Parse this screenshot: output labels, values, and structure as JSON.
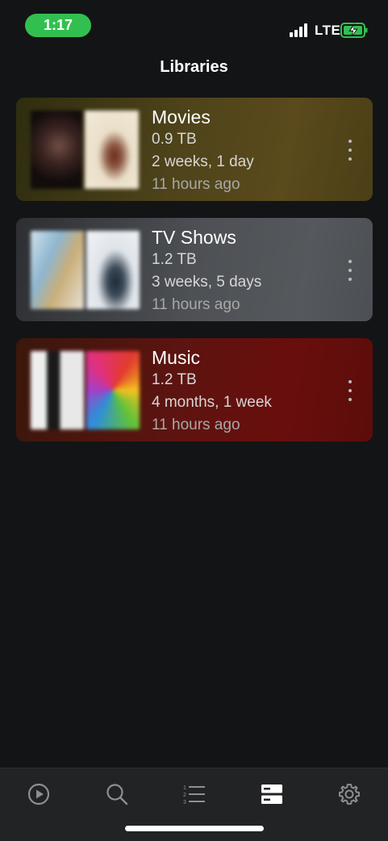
{
  "status_bar": {
    "time": "1:17",
    "network": "LTE",
    "time_pill_color": "#31c04f",
    "battery_color": "#31c04f"
  },
  "header": {
    "title": "Libraries"
  },
  "libraries": [
    {
      "title": "Movies",
      "size": "0.9 TB",
      "duration": "2 weeks, 1 day",
      "updated": "11 hours ago",
      "tint": "#4e431a",
      "menu_icon": "more-vertical-icon"
    },
    {
      "title": "TV Shows",
      "size": "1.2 TB",
      "duration": "3 weeks, 5 days",
      "updated": "11 hours ago",
      "tint": "#4d5054",
      "menu_icon": "more-vertical-icon"
    },
    {
      "title": "Music",
      "size": "1.2 TB",
      "duration": "4 months, 1 week",
      "updated": "11 hours ago",
      "tint": "#5d1410",
      "menu_icon": "more-vertical-icon"
    }
  ],
  "tab_bar": {
    "tabs": [
      {
        "icon": "play-circle-icon",
        "active": false
      },
      {
        "icon": "search-icon",
        "active": false
      },
      {
        "icon": "numbered-list-icon",
        "active": false
      },
      {
        "icon": "server-icon",
        "active": true
      },
      {
        "icon": "gear-icon",
        "active": false
      }
    ],
    "active_color": "#ffffff",
    "inactive_color": "#8e8e93"
  }
}
